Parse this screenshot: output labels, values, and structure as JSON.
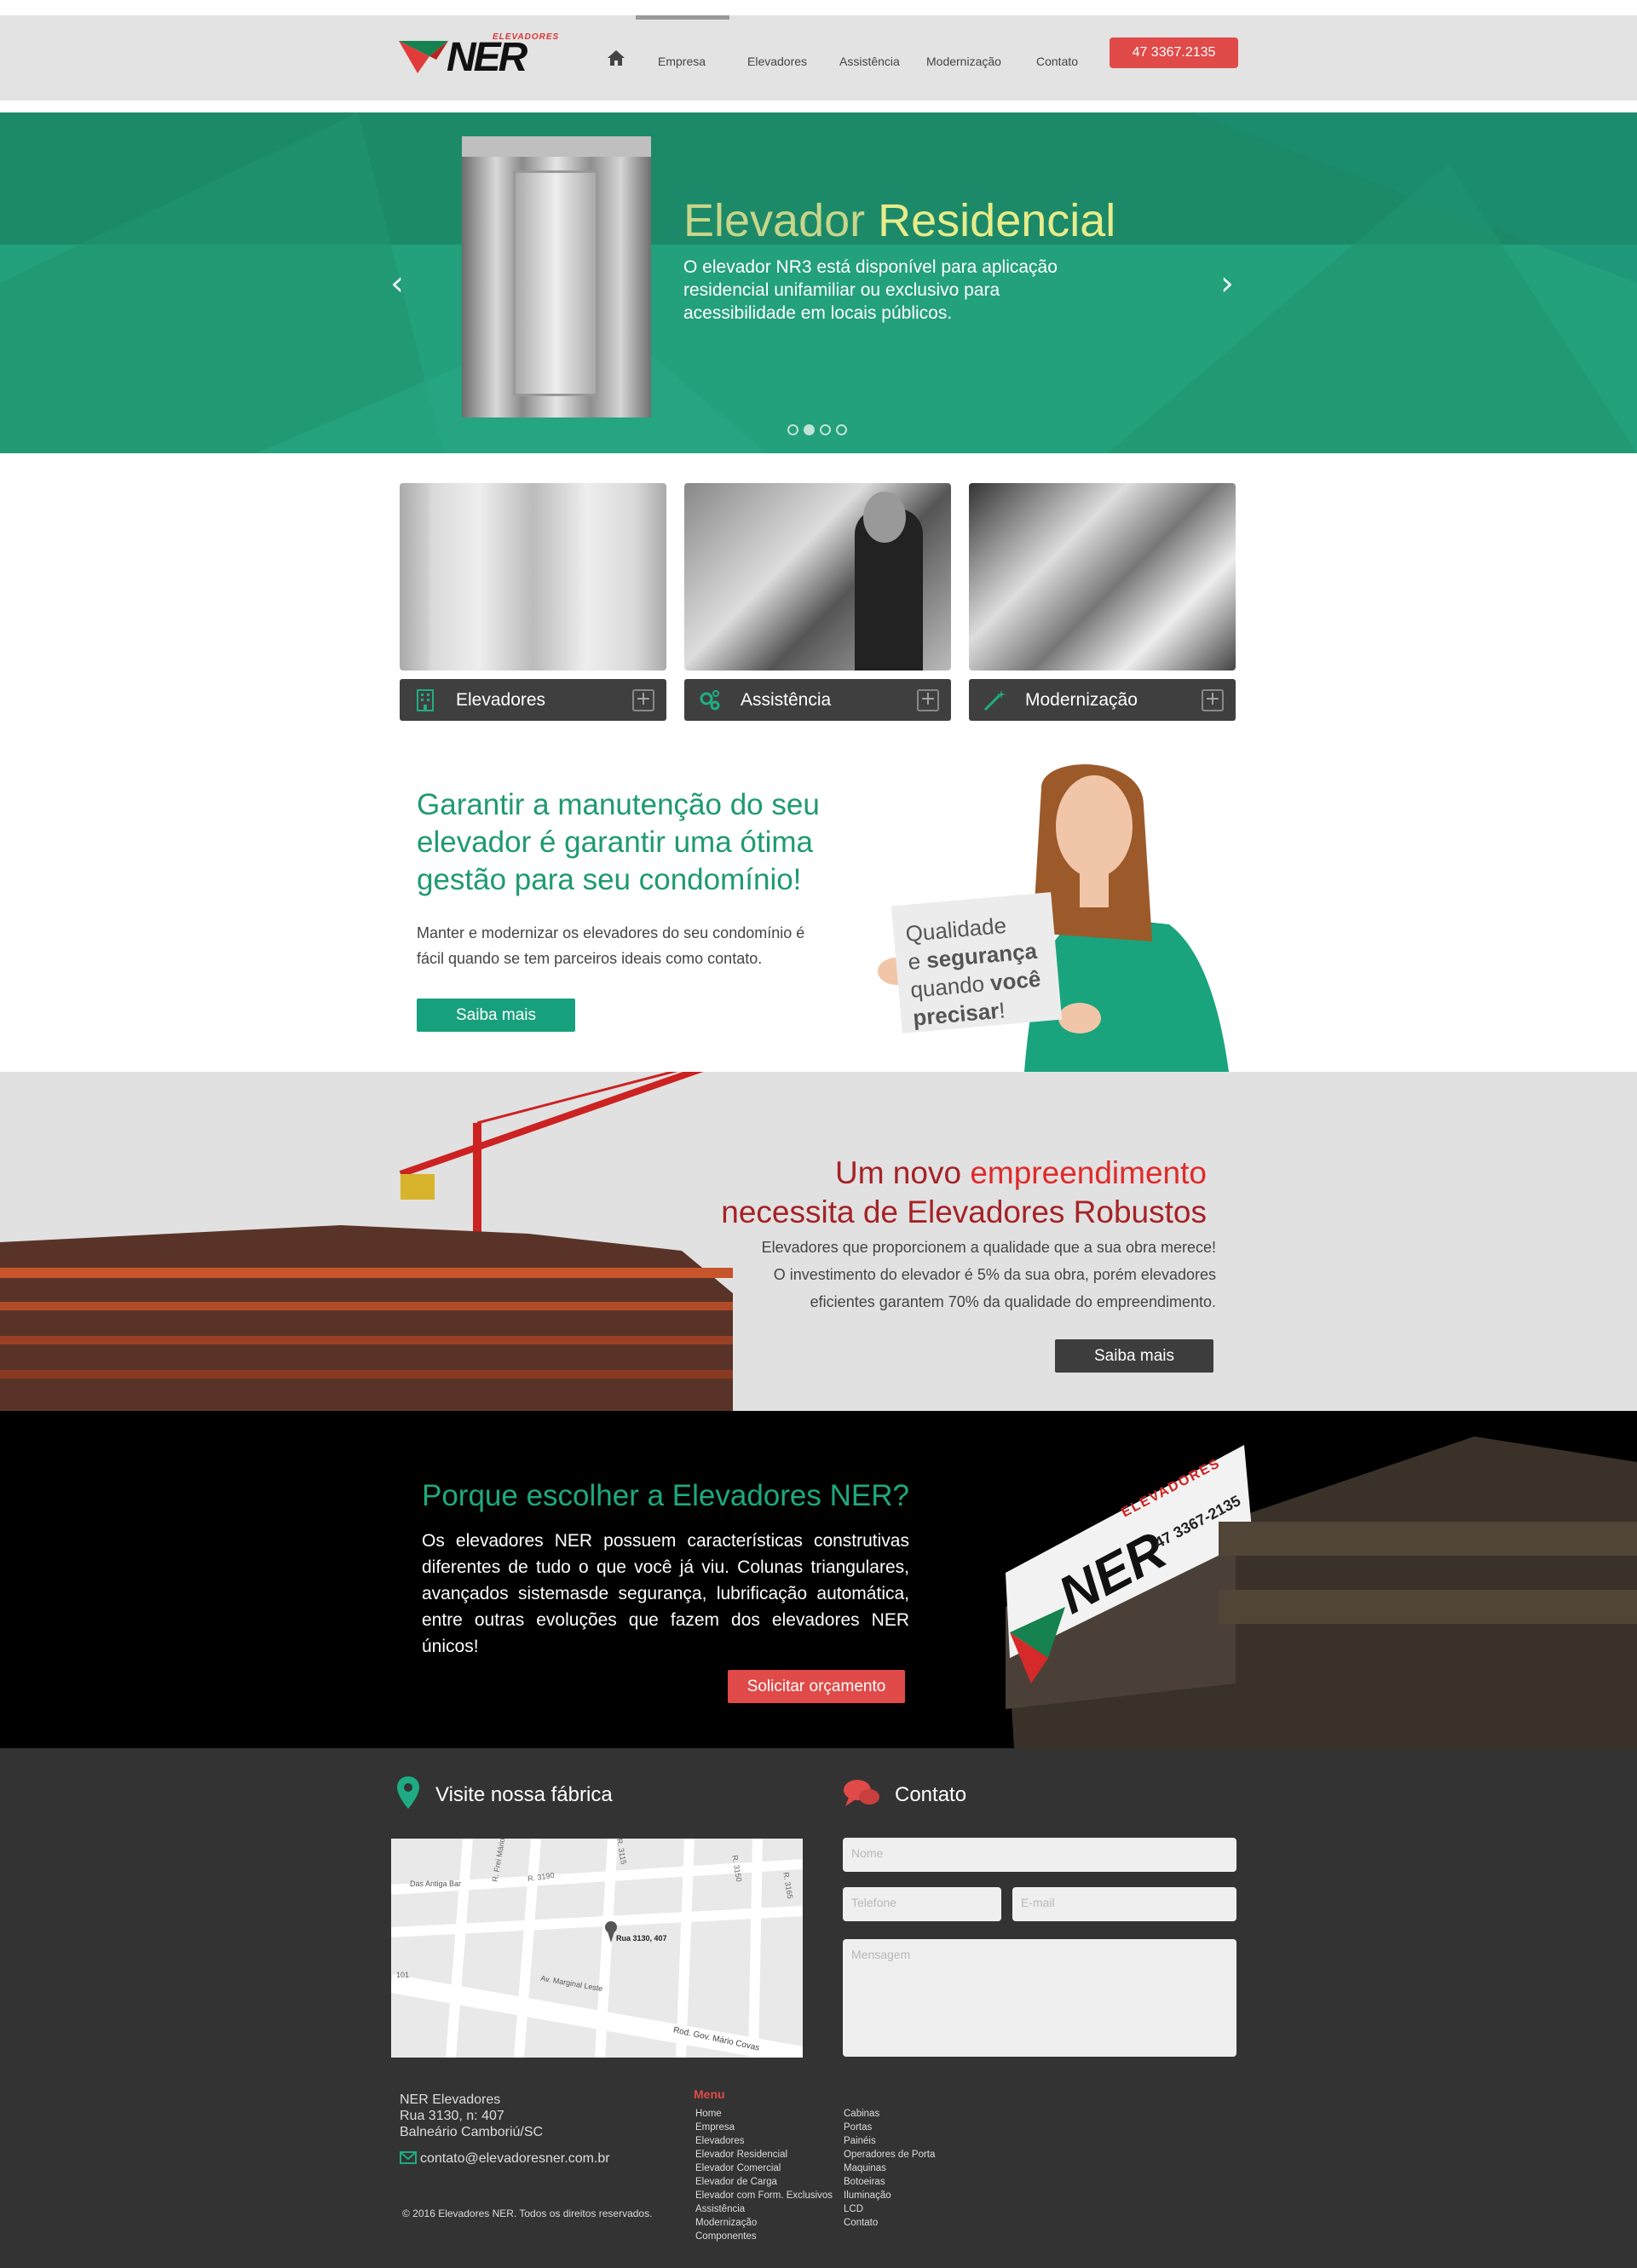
{
  "header": {
    "logo_text": "NER",
    "logo_subtext": "ELEVADORES",
    "nav": [
      "Empresa",
      "Elevadores",
      "Assistência",
      "Modernização",
      "Contato"
    ],
    "phone": "47 3367.2135"
  },
  "hero": {
    "title_light": "Elevador",
    "title_bold": "Residencial",
    "text": "O elevador NR3 está disponível para aplicação residencial unifamiliar ou exclusivo para acessibilidade em locais públicos.",
    "slide_count": 4,
    "active_slide": 2
  },
  "cards": [
    {
      "label": "Elevadores",
      "icon": "building-icon"
    },
    {
      "label": "Assistência",
      "icon": "gears-icon"
    },
    {
      "label": "Modernização",
      "icon": "magic-wand-icon"
    }
  ],
  "maintenance": {
    "title": "Garantir a manutenção do seu elevador é garantir uma ótima gestão para seu condomínio!",
    "text": "Manter e modernizar os elevadores do seu condomínio é fácil quando se tem parceiros ideais como contato.",
    "button": "Saiba mais",
    "sign": {
      "l1a": "Qualidade",
      "l2a": "e ",
      "l2b": "segurança",
      "l3a": "quando ",
      "l3b": "você",
      "l4a": "precisar",
      "l4b": "!"
    }
  },
  "construction": {
    "title_a": "Um novo ",
    "title_b": "empreendimento",
    "title_c": "necessita de Elevadores Robustos",
    "text_1": "Elevadores que proporcionem a qualidade que a sua obra merece!",
    "text_2": "O investimento do elevador é 5% da sua obra, porém elevadores",
    "text_3": "eficientes garantem 70% da qualidade do empreendimento.",
    "button": "Saiba mais"
  },
  "why": {
    "title": "Porque escolher a Elevadores NER?",
    "text": "Os elevadores NER possuem características construtivas diferentes de tudo o que você já viu. Colunas triangulares, avançados sistemasde segurança, lubrificação automática, entre outras evoluções que fazem dos elevadores NER únicos!",
    "button": "Solicitar orçamento",
    "sign_brand": "NER",
    "sign_sub": "ELEVADORES",
    "sign_phone": "47 3367-2135"
  },
  "footer": {
    "visit_title": "Visite nossa fábrica",
    "contact_title": "Contato",
    "map": {
      "pin_label": "Rua 3130, 407",
      "streets": [
        "Das Antiga Bar",
        "R. 3190",
        "R. 3150",
        "R. 3115",
        "R. 3165",
        "Av. Marginal Leste",
        "Rod. Gov. Mário Covas",
        "R. Frei Mário",
        "101"
      ]
    },
    "form": {
      "name": "Nome",
      "phone": "Telefone",
      "email": "E-mail",
      "message": "Mensagem"
    },
    "address": [
      "NER Elevadores",
      "Rua 3130, n: 407",
      "Balneário Camboriú/SC"
    ],
    "email": "contato@elevadoresner.com.br",
    "copyright": "© 2016 Elevadores NER. Todos os direitos reservados.",
    "menu_title": "Menu",
    "menu_col1": [
      "Home",
      "Empresa",
      "Elevadores",
      "Elevador Residencial",
      "Elevador Comercial",
      "Elevador de Carga",
      "Elevador com Form. Exclusivos",
      "Assistência",
      "Modernização",
      "Componentes"
    ],
    "menu_col2": [
      "Cabinas",
      "Portas",
      "Painéis",
      "Operadores de Porta",
      "Maquinas",
      "Botoeiras",
      "Iluminação",
      "LCD",
      "Contato"
    ]
  },
  "colors": {
    "brand_green": "#1e9a72",
    "brand_red": "#e04a48",
    "dark": "#333333"
  }
}
